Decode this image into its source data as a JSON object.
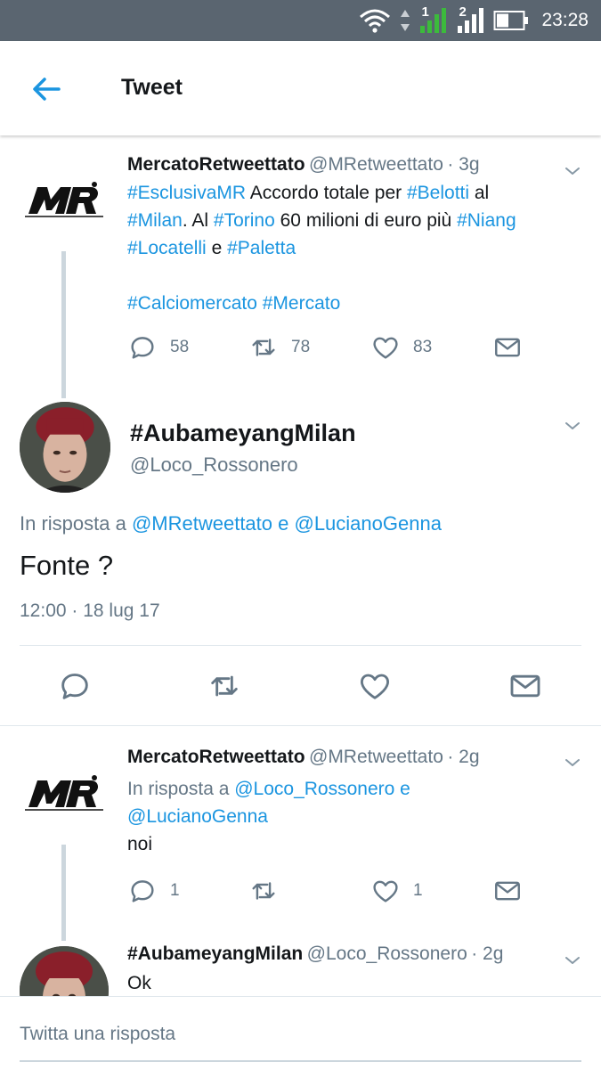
{
  "status_bar": {
    "time": "23:28",
    "sim1": "1",
    "sim2": "2"
  },
  "header": {
    "title": "Tweet"
  },
  "tweet1": {
    "name": "MercatoRetweettato",
    "handle": "@MRetweettato",
    "time": "· 3g",
    "line1": [
      "#EsclusivaMR",
      " Accordo totale per ",
      "#Belotti",
      " al"
    ],
    "line2": [
      "#Milan",
      ". Al ",
      "#Torino",
      " 60 milioni di euro più ",
      "#Niang"
    ],
    "line3": [
      "#Locatelli",
      " e ",
      "#Paletta"
    ],
    "line4": [
      "#Calciomercato",
      " ",
      "#Mercato"
    ],
    "replies": "58",
    "retweets": "78",
    "likes": "83"
  },
  "main_tweet": {
    "name": "#AubameyangMilan",
    "handle": "@Loco_Rossonero",
    "reply_prefix": "In risposta a ",
    "reply_user1": "@MRetweettato",
    "reply_and": " e ",
    "reply_user2": "@LucianoGenna",
    "text": "Fonte ?",
    "timestamp": "12:00 · 18 lug 17"
  },
  "tweet3": {
    "name": "MercatoRetweettato",
    "handle": "@MRetweettato",
    "time": "· 2g",
    "reply_prefix": "In risposta a ",
    "reply_user1": "@Loco_Rossonero",
    "reply_and": " e",
    "reply_user2": "@LucianoGenna",
    "text": "noi",
    "replies": "1",
    "likes": "1"
  },
  "tweet4": {
    "name": "#AubameyangMilan",
    "handle": "@Loco_Rossonero",
    "time": "· 2g",
    "text": "Ok"
  },
  "composer": {
    "placeholder": "Twitta una risposta"
  },
  "colors": {
    "link": "#1b95e0",
    "secondary": "#657786",
    "status_bar": "#5a6570",
    "signal_green": "#3cba3c"
  },
  "icons": [
    "wifi-icon",
    "signal-icon",
    "battery-icon",
    "back-arrow-icon",
    "chevron-down-icon",
    "reply-icon",
    "retweet-icon",
    "like-icon",
    "dm-icon"
  ]
}
